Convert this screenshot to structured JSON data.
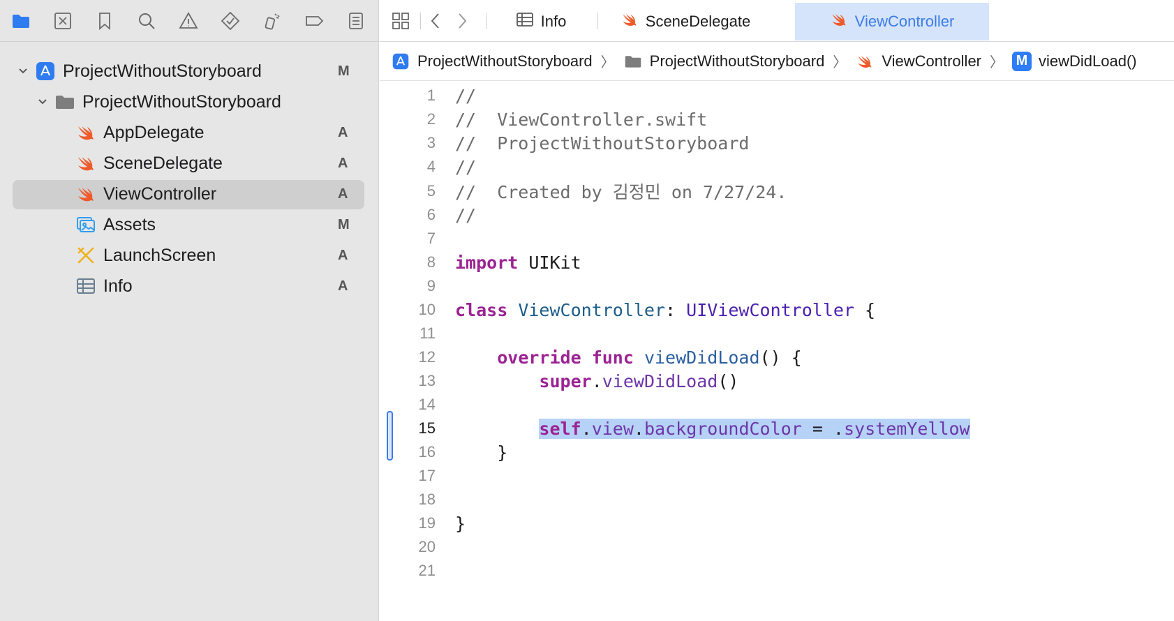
{
  "colors": {
    "accent": "#3b7cea",
    "swift_orange": "#ef5a2c",
    "selection": "#b7d2f7",
    "keyword": "#9b2393"
  },
  "navigator": {
    "toolbar_icons": [
      "folder-icon",
      "source-control-icon",
      "bookmark-icon",
      "search-icon",
      "warning-icon",
      "test-icon",
      "debug-icon",
      "breakpoint-icon",
      "report-icon"
    ],
    "items": [
      {
        "label": "ProjectWithoutStoryboard",
        "status": "M",
        "icon": "app-project-icon"
      },
      {
        "label": "ProjectWithoutStoryboard",
        "status": "",
        "icon": "folder-icon"
      },
      {
        "label": "AppDelegate",
        "status": "A",
        "icon": "swift-icon"
      },
      {
        "label": "SceneDelegate",
        "status": "A",
        "icon": "swift-icon"
      },
      {
        "label": "ViewController",
        "status": "A",
        "icon": "swift-icon"
      },
      {
        "label": "Assets",
        "status": "M",
        "icon": "assets-icon"
      },
      {
        "label": "LaunchScreen",
        "status": "A",
        "icon": "storyboard-icon"
      },
      {
        "label": "Info",
        "status": "A",
        "icon": "plist-icon"
      }
    ]
  },
  "tabs": [
    {
      "label": "Info",
      "icon": "plist-icon"
    },
    {
      "label": "SceneDelegate",
      "icon": "swift-icon"
    },
    {
      "label": "ViewController",
      "icon": "swift-icon",
      "active": true
    }
  ],
  "breadcrumb": [
    {
      "label": "ProjectWithoutStoryboard",
      "icon": "app-project-icon"
    },
    {
      "label": "ProjectWithoutStoryboard",
      "icon": "folder-icon"
    },
    {
      "label": "ViewController",
      "icon": "swift-icon"
    },
    {
      "label": "viewDidLoad()",
      "icon": "method-icon",
      "badge": "M"
    }
  ],
  "editor": {
    "current_line": 15,
    "line_numbers": [
      "1",
      "2",
      "3",
      "4",
      "5",
      "6",
      "7",
      "8",
      "9",
      "10",
      "11",
      "12",
      "13",
      "14",
      "15",
      "16",
      "17",
      "18",
      "19",
      "20",
      "21"
    ],
    "code": {
      "l1": "//",
      "l2": "//  ViewController.swift",
      "l3": "//  ProjectWithoutStoryboard",
      "l4": "//",
      "l5": "//  Created by 김정민 on 7/27/24.",
      "l6": "//",
      "l8_kw": "import",
      "l8_rest": " UIKit",
      "l10_kw": "class",
      "l10_name": " ViewController",
      "l10_colon": ": ",
      "l10_super": "UIViewController",
      "l10_brace": " {",
      "l12_indent": "    ",
      "l12_kw1": "override",
      "l12_kw2": " func",
      "l12_name": " viewDidLoad",
      "l12_rest": "() {",
      "l13_indent": "        ",
      "l13_kw": "super",
      "l13_dot": ".",
      "l13_call": "viewDidLoad",
      "l13_rest": "()",
      "l15_indent": "        ",
      "l15_kw": "self",
      "l15_d1": ".",
      "l15_view": "view",
      "l15_d2": ".",
      "l15_prop": "backgroundColor",
      "l15_eq": " = .",
      "l15_val": "systemYellow",
      "l16": "    }",
      "l19": "}"
    }
  }
}
